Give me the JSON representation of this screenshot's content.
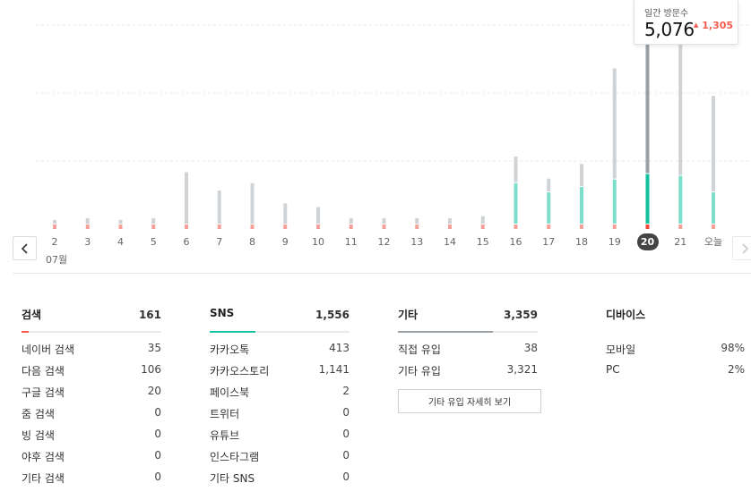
{
  "chart": {
    "month_label": "07월",
    "selected_index": 18,
    "tooltip": {
      "title": "일간 방문수",
      "value": "5,076",
      "delta_arrow": "▲",
      "delta": "1,305"
    },
    "colors": {
      "gray": "#cfd3d6",
      "gray_selected": "#9aa1a6",
      "teal": "#7ddecb",
      "teal_selected": "#10c29d",
      "red": "#f5a09a",
      "red_selected": "#ef4a3c",
      "gridline": "#e9e9e9"
    },
    "icons": {
      "prev": "chevron-left-icon",
      "next": "chevron-right-icon"
    }
  },
  "chart_data": {
    "type": "bar",
    "stacked": true,
    "categories": [
      "2",
      "3",
      "4",
      "5",
      "6",
      "7",
      "8",
      "9",
      "10",
      "11",
      "12",
      "13",
      "14",
      "15",
      "16",
      "17",
      "18",
      "19",
      "20",
      "21",
      "오늘"
    ],
    "series": [
      {
        "values": [
          60,
          50,
          50,
          50,
          50,
          50,
          50,
          50,
          50,
          50,
          50,
          50,
          50,
          50,
          50,
          50,
          50,
          50,
          50,
          50,
          50
        ]
      },
      {
        "values": [
          0,
          0,
          0,
          0,
          0,
          0,
          0,
          0,
          0,
          0,
          0,
          0,
          0,
          0,
          1100,
          850,
          1000,
          1200,
          1350,
          1300,
          850
        ]
      },
      {
        "values": [
          100,
          150,
          100,
          150,
          1400,
          900,
          1100,
          550,
          450,
          150,
          150,
          150,
          150,
          200,
          700,
          350,
          600,
          3000,
          3700,
          4200,
          2600
        ]
      }
    ],
    "ylim": [
      0,
      5500
    ]
  },
  "stats": {
    "search": {
      "title": "검색",
      "total": "161",
      "accent": "#f25a4c",
      "fill_ratio": 0.05,
      "rows": [
        {
          "label": "네이버 검색",
          "value": "35"
        },
        {
          "label": "다음 검색",
          "value": "106"
        },
        {
          "label": "구글 검색",
          "value": "20"
        },
        {
          "label": "줌 검색",
          "value": "0"
        },
        {
          "label": "빙 검색",
          "value": "0"
        },
        {
          "label": "야후 검색",
          "value": "0"
        },
        {
          "label": "기타 검색",
          "value": "0"
        }
      ]
    },
    "sns": {
      "title": "SNS",
      "total": "1,556",
      "accent": "#17c5a2",
      "fill_ratio": 0.33,
      "rows": [
        {
          "label": "카카오톡",
          "value": "413"
        },
        {
          "label": "카카오스토리",
          "value": "1,141"
        },
        {
          "label": "페이스북",
          "value": "2"
        },
        {
          "label": "트위터",
          "value": "0"
        },
        {
          "label": "유튜브",
          "value": "0"
        },
        {
          "label": "인스타그램",
          "value": "0"
        },
        {
          "label": "기타 SNS",
          "value": "0"
        }
      ]
    },
    "other": {
      "title": "기타",
      "total": "3,359",
      "accent": "#9aa1a6",
      "fill_ratio": 0.68,
      "rows": [
        {
          "label": "직접 유입",
          "value": "38"
        },
        {
          "label": "기타 유입",
          "value": "3,321"
        }
      ],
      "detail_button": "기타 유입 자세히 보기"
    },
    "device": {
      "title": "디바이스",
      "rows": [
        {
          "label": "모바일",
          "value": "98%"
        },
        {
          "label": "PC",
          "value": "2%"
        }
      ]
    }
  }
}
